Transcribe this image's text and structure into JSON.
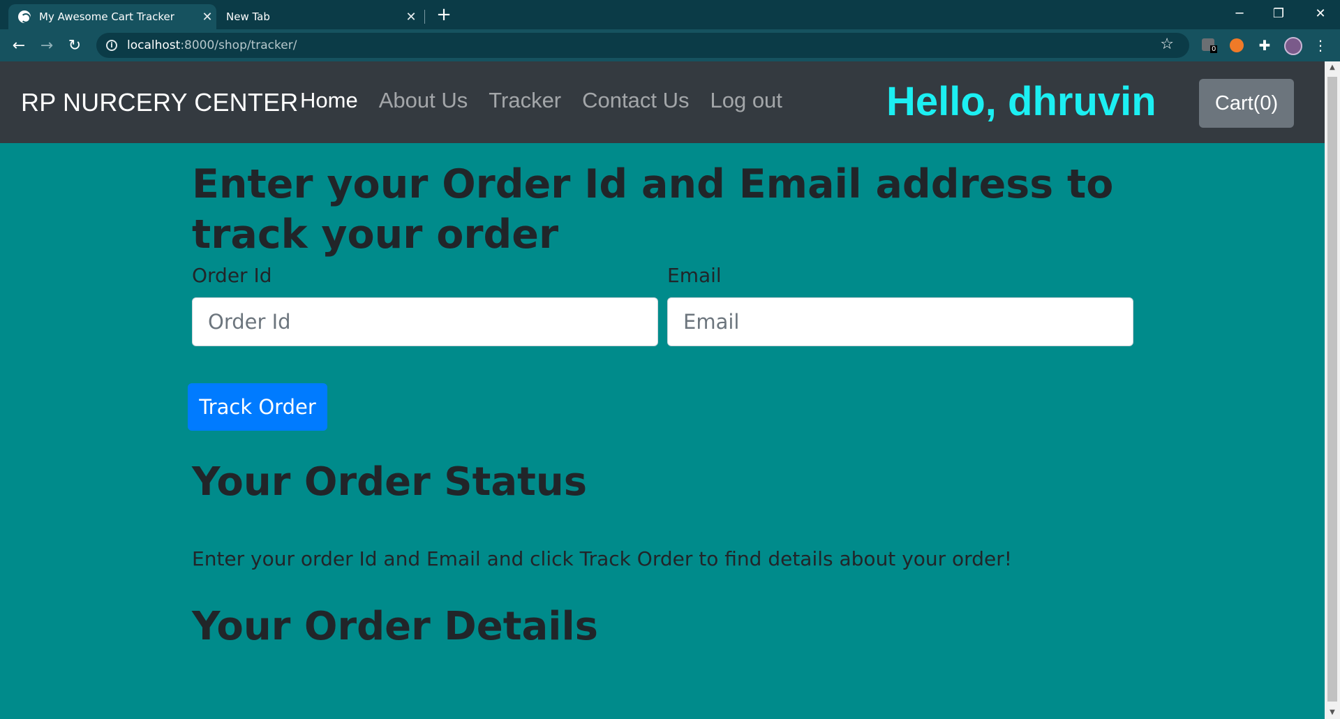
{
  "browser": {
    "tabs": [
      {
        "title": "My Awesome Cart Tracker",
        "active": true
      },
      {
        "title": "New Tab",
        "active": false
      }
    ],
    "url_host": "localhost",
    "url_path": ":8000/shop/tracker/",
    "extension_badge": "0"
  },
  "navbar": {
    "brand": "RP NURCERY CENTER",
    "links": [
      "Home",
      "About Us",
      "Tracker",
      "Contact Us",
      "Log out"
    ],
    "active_link": "Home",
    "greeting": "Hello, dhruvin",
    "cart_label": "Cart(0)"
  },
  "tracker": {
    "heading": "Enter your Order Id and Email address to track your order",
    "order_id_label": "Order Id",
    "order_id_placeholder": "Order Id",
    "email_label": "Email",
    "email_placeholder": "Email",
    "button_label": "Track Order",
    "status_heading": "Your Order Status",
    "status_text": "Enter your order Id and Email and click Track Order to find details about your order!",
    "details_heading": "Your Order Details"
  },
  "colors": {
    "page_bg": "#008b8b",
    "navbar_bg": "#343a40",
    "greeting": "#1ceff2",
    "primary_button": "#007bff",
    "cart_button": "#6c757d"
  }
}
